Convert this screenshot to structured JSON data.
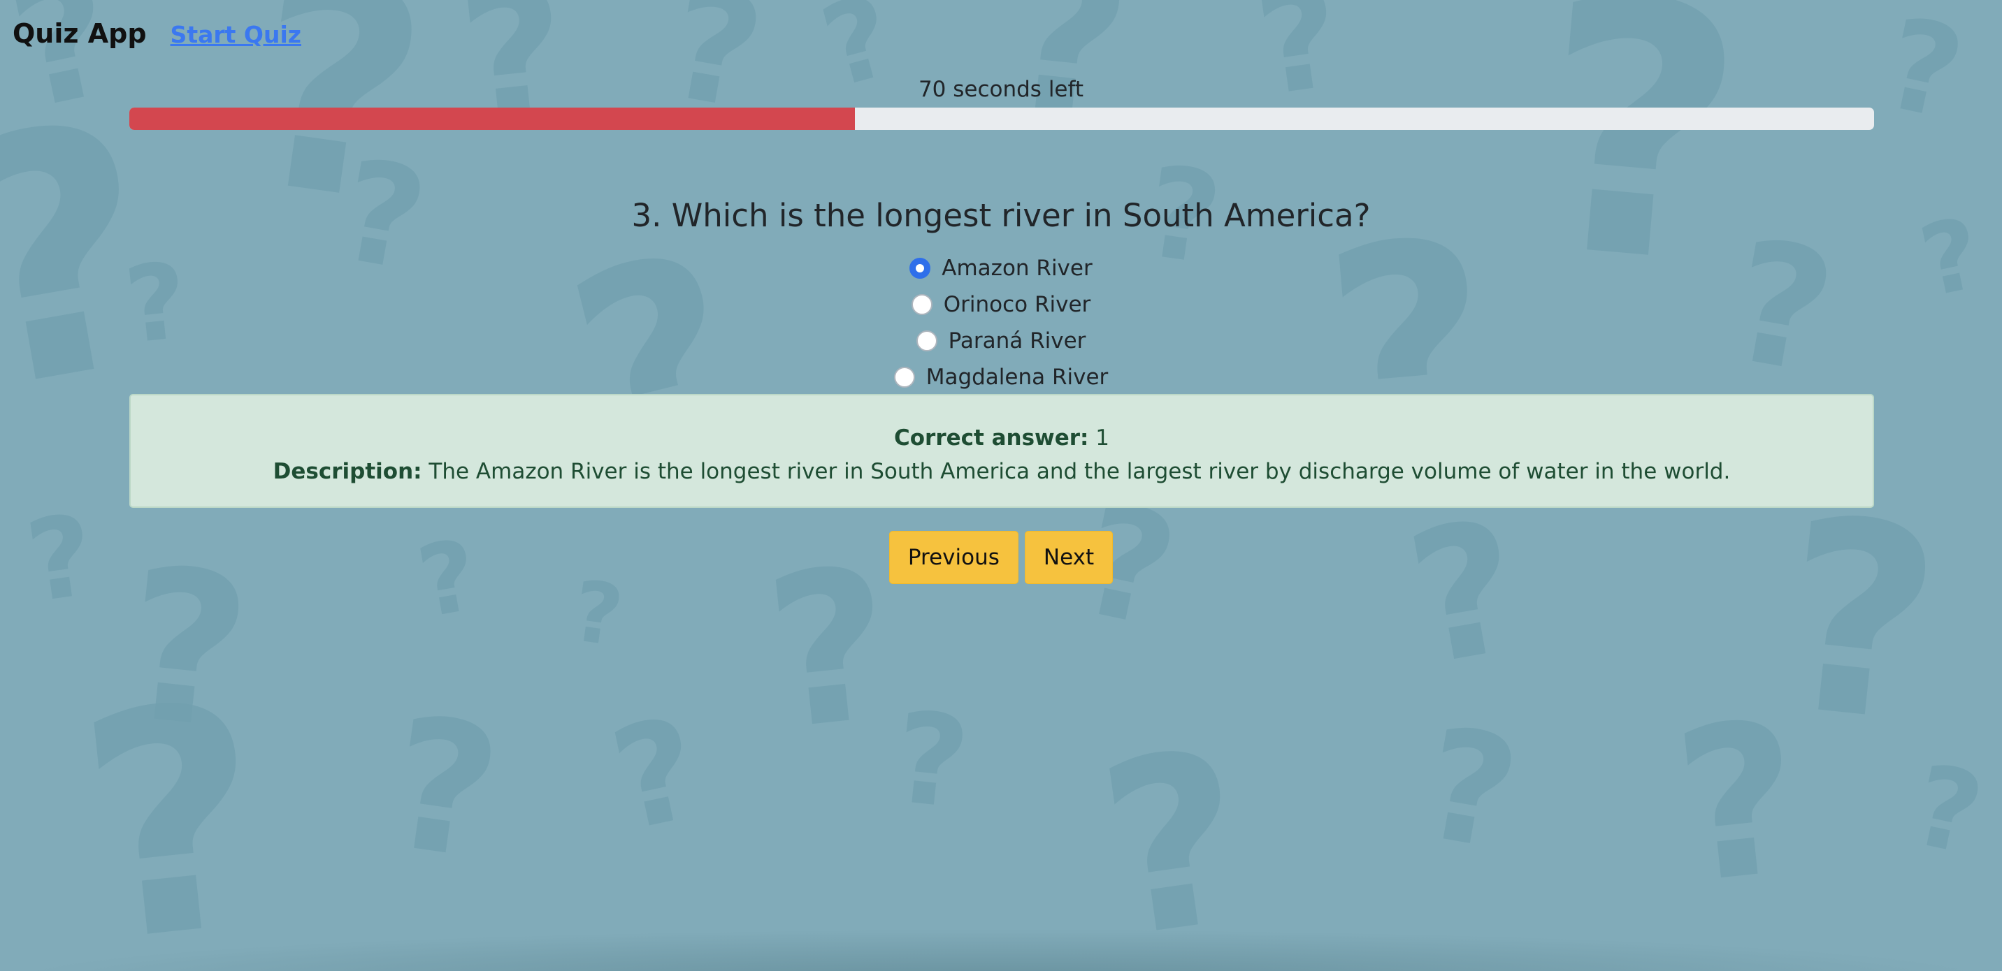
{
  "navbar": {
    "brand": "Quiz App",
    "start_quiz_link": "Start Quiz"
  },
  "timer": {
    "text": "70 seconds left",
    "progress_fraction": 0.416
  },
  "question": {
    "text": "3. Which is the longest river in South America?",
    "options": [
      {
        "label": "Amazon River",
        "selected": true
      },
      {
        "label": "Orinoco River",
        "selected": false
      },
      {
        "label": "Paraná River",
        "selected": false
      },
      {
        "label": "Magdalena River",
        "selected": false
      }
    ]
  },
  "feedback": {
    "correct_answer_label": "Correct answer:",
    "correct_answer_value": "1",
    "description_label": "Description:",
    "description_text": "The Amazon River is the longest river in South America and the largest river by discharge volume of water in the world."
  },
  "buttons": {
    "previous": "Previous",
    "next": "Next"
  },
  "colors": {
    "background": "#81abb9",
    "progress_fill": "#d3474f",
    "button": "#f6c23e",
    "alert_bg": "#d4e7dc",
    "radio_selected": "#2f6fea"
  }
}
